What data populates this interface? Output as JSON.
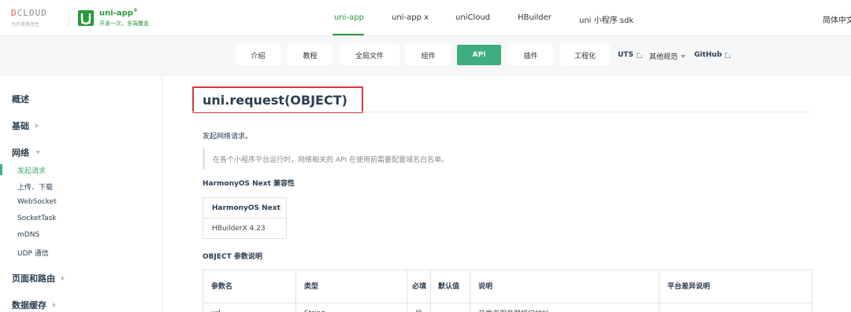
{
  "brand": {
    "dcloud_prefix": "D",
    "dcloud_word": "CLOUD",
    "dcloud_tagline": "为开发者而生",
    "uni_name": "uni-app",
    "uni_reg": "®",
    "uni_slogan": "开发一次，多端覆盖",
    "accent": "#2b9939"
  },
  "topnav": {
    "items": [
      "uni-app",
      "uni-app x",
      "uniCloud",
      "HBuilder",
      "uni 小程序 sdk"
    ],
    "active": "uni-app",
    "lang": "简体中文"
  },
  "subnav": {
    "pills": [
      "介绍",
      "教程",
      "全局文件",
      "组件",
      "API",
      "插件",
      "工程化"
    ],
    "active": "API",
    "links": [
      "UTS",
      "其他规范",
      "GitHub"
    ]
  },
  "sidebar": {
    "groups": [
      "概述",
      "基础",
      "网络",
      "页面和路由",
      "数据缓存"
    ],
    "network_items": [
      "发起请求",
      "上传、下载",
      "WebSocket",
      "SocketTask",
      "mDNS",
      "UDP 通信"
    ],
    "active_item": "发起请求"
  },
  "content": {
    "title": "uni.request(OBJECT)",
    "description": "发起网络请求。",
    "tip": "在各个小程序平台运行时，网络相关的 API 在使用前需要配置域名白名单。",
    "compat_heading": "HarmonyOS Next 兼容性",
    "compat_table": {
      "header": "HarmonyOS Next",
      "value": "HBuilderX 4.23"
    },
    "object_heading": "OBJECT 参数说明",
    "param_table": {
      "headers": [
        "参数名",
        "类型",
        "必填",
        "默认值",
        "说明",
        "平台差异说明"
      ],
      "first_row": [
        "url",
        "String",
        "是",
        "",
        "开发者服务器接口地址",
        ""
      ]
    }
  }
}
